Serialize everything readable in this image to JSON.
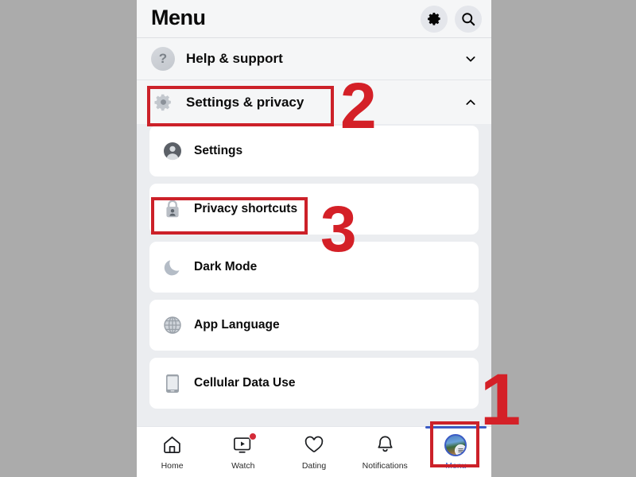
{
  "header": {
    "title": "Menu",
    "gear_icon": "gear-icon",
    "search_icon": "search-icon"
  },
  "help_row": {
    "label": "Help & support",
    "icon": "question-mark-icon",
    "chevron": "chevron-down-icon"
  },
  "settings_section": {
    "label": "Settings & privacy",
    "icon": "gear-icon",
    "chevron": "chevron-up-icon",
    "expanded": true
  },
  "menu_items": [
    {
      "label": "Settings",
      "icon": "person-circle-icon"
    },
    {
      "label": "Privacy shortcuts",
      "icon": "lock-person-icon"
    },
    {
      "label": "Dark Mode",
      "icon": "moon-icon"
    },
    {
      "label": "App Language",
      "icon": "globe-icon"
    },
    {
      "label": "Cellular Data Use",
      "icon": "phone-icon"
    }
  ],
  "tabbar": [
    {
      "label": "Home",
      "icon": "home-icon",
      "active": false,
      "badge": false
    },
    {
      "label": "Watch",
      "icon": "watch-video-icon",
      "active": false,
      "badge": true
    },
    {
      "label": "Dating",
      "icon": "dating-hearts-icon",
      "active": false,
      "badge": false
    },
    {
      "label": "Notifications",
      "icon": "bell-icon",
      "active": false,
      "badge": false
    },
    {
      "label": "Menu",
      "icon": "avatar-menu-icon",
      "active": true,
      "badge": false
    }
  ],
  "annotations": [
    {
      "number": "1",
      "target": "menu-tab"
    },
    {
      "number": "2",
      "target": "settings-and-privacy-row"
    },
    {
      "number": "3",
      "target": "privacy-shortcuts-row"
    }
  ],
  "colors": {
    "annotation_red": "#cc2129",
    "active_tab_blue": "#3b5bc4",
    "outer_background": "#ababab",
    "card_background": "#ffffff",
    "section_background": "#f5f6f7"
  }
}
